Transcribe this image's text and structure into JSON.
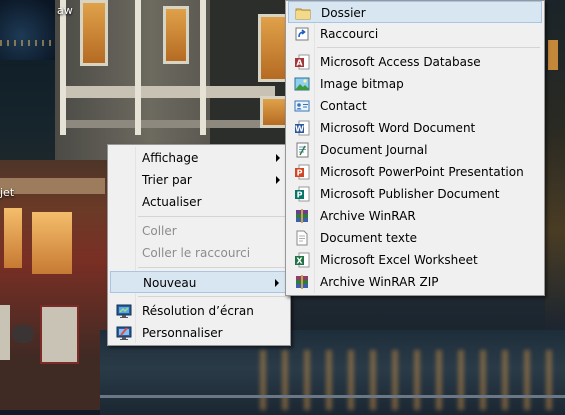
{
  "desktop": {
    "icons": [
      {
        "label": "aw"
      },
      {
        "label": "jet"
      }
    ]
  },
  "context_menu": {
    "items": [
      {
        "label": "Affichage",
        "submenu": true,
        "enabled": true
      },
      {
        "label": "Trier par",
        "submenu": true,
        "enabled": true
      },
      {
        "label": "Actualiser",
        "enabled": true
      },
      {
        "label": "Coller",
        "enabled": false
      },
      {
        "label": "Coller le raccourci",
        "enabled": false
      },
      {
        "label": "Nouveau",
        "submenu": true,
        "enabled": true,
        "highlighted": true
      },
      {
        "label": "Résolution d’écran",
        "icon": "display-settings-icon",
        "enabled": true
      },
      {
        "label": "Personnaliser",
        "icon": "personalize-icon",
        "enabled": true
      }
    ]
  },
  "new_submenu": {
    "items": [
      {
        "label": "Dossier",
        "icon": "folder-icon",
        "highlighted": true
      },
      {
        "label": "Raccourci",
        "icon": "shortcut-icon"
      },
      {
        "label": "Microsoft Access Database",
        "icon": "access-icon"
      },
      {
        "label": "Image bitmap",
        "icon": "bitmap-icon"
      },
      {
        "label": "Contact",
        "icon": "contact-card-icon"
      },
      {
        "label": "Microsoft Word Document",
        "icon": "word-icon"
      },
      {
        "label": "Document Journal",
        "icon": "journal-icon"
      },
      {
        "label": "Microsoft PowerPoint Presentation",
        "icon": "powerpoint-icon"
      },
      {
        "label": "Microsoft Publisher Document",
        "icon": "publisher-icon"
      },
      {
        "label": "Archive WinRAR",
        "icon": "winrar-icon"
      },
      {
        "label": "Document texte",
        "icon": "text-document-icon"
      },
      {
        "label": "Microsoft Excel Worksheet",
        "icon": "excel-icon"
      },
      {
        "label": "Archive WinRAR ZIP",
        "icon": "winrar-zip-icon"
      }
    ]
  },
  "colors": {
    "menu_background": "#f0f0f0",
    "highlight": "#d8e6f2",
    "highlight_border": "#a8c6e4",
    "disabled_text": "#8c8c8c"
  }
}
